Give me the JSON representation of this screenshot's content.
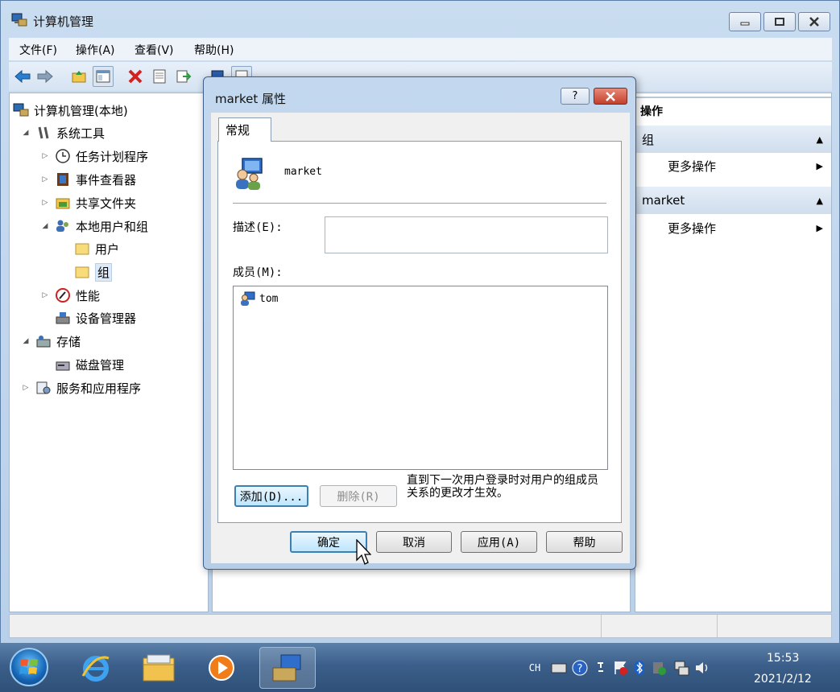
{
  "window": {
    "title": "计算机管理"
  },
  "menu": [
    "文件(F)",
    "操作(A)",
    "查看(V)",
    "帮助(H)"
  ],
  "tree": {
    "root": "计算机管理(本地)",
    "system_tools": "系统工具",
    "task_scheduler": "任务计划程序",
    "event_viewer": "事件查看器",
    "shared_folders": "共享文件夹",
    "local_users_groups": "本地用户和组",
    "users": "用户",
    "groups": "组",
    "performance": "性能",
    "device_manager": "设备管理器",
    "storage": "存储",
    "disk_management": "磁盘管理",
    "services_apps": "服务和应用程序"
  },
  "actions": {
    "title": "操作",
    "section1": "组",
    "more1": "更多操作",
    "section2": "market",
    "more2": "更多操作"
  },
  "dialog": {
    "title": "market 属性",
    "tab": "常规",
    "group_name": "market",
    "desc_label": "描述(E):",
    "desc_value": "",
    "members_label": "成员(M):",
    "members": [
      "tom"
    ],
    "add_button": "添加(D)...",
    "remove_button": "删除(R)",
    "note": "直到下一次用户登录时对用户的组成员关系的更改才生效。",
    "ok": "确定",
    "cancel": "取消",
    "apply": "应用(A)",
    "help": "帮助"
  },
  "taskbar": {
    "lang": "CH",
    "time": "15:53",
    "date": "2021/2/12"
  }
}
